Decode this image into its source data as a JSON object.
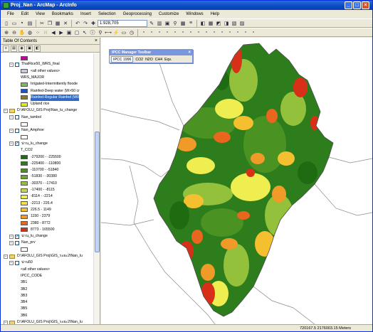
{
  "window": {
    "title": "Proj_Nan - ArcMap - ArcInfo"
  },
  "menu": [
    "File",
    "Edit",
    "View",
    "Bookmarks",
    "Insert",
    "Selection",
    "Geoprocessing",
    "Customize",
    "Windows",
    "Help"
  ],
  "toolbar": {
    "scale": "1:928,705"
  },
  "toc": {
    "title": "Table Of Contents",
    "rows": [
      {
        "type": "swatch",
        "color": "#c8009c",
        "label": ""
      },
      {
        "type": "layer",
        "label": "ThaiRice50_WRS_final",
        "checked": false
      },
      {
        "type": "swatch",
        "color": "#c9c6e6",
        "label": "<all other values>"
      },
      {
        "type": "text",
        "label": "WRS_MAJOR"
      },
      {
        "type": "swatch",
        "color": "#82b46a",
        "label": "Irrigated-Intermittently floode"
      },
      {
        "type": "swatch",
        "color": "#1a4fd6",
        "label": "Rainfed-Deep water (W>50 cr"
      },
      {
        "type": "swatch",
        "color": "#8a7a2a",
        "label": "Rainfed-Regular Rainfed (W0",
        "highlight": true
      },
      {
        "type": "swatch",
        "color": "#e8e820",
        "label": "Upland rice"
      },
      {
        "type": "group",
        "label": "D:\\AFOLU_GIS Proj\\Nan_lu_change"
      },
      {
        "type": "layer",
        "label": "Nan_tambol",
        "checked": false
      },
      {
        "type": "outline",
        "label": ""
      },
      {
        "type": "layer",
        "label": "Nan_Amphoe",
        "checked": false
      },
      {
        "type": "outline",
        "label": ""
      },
      {
        "type": "layer",
        "label": "น่าน_lu_change",
        "checked": true
      },
      {
        "type": "text",
        "label": "T_CO2"
      },
      {
        "type": "swatch",
        "color": "#1f6b12",
        "label": "-279200 - -225500"
      },
      {
        "type": "swatch",
        "color": "#2e7d1c",
        "label": "-225400 - -110800"
      },
      {
        "type": "swatch",
        "color": "#4a9322",
        "label": "-110700 - -51840"
      },
      {
        "type": "swatch",
        "color": "#6aa82e",
        "label": "-51830 - -30380"
      },
      {
        "type": "swatch",
        "color": "#93c13c",
        "label": "-30370 - -17410"
      },
      {
        "type": "swatch",
        "color": "#c3d84c",
        "label": "-17400 - -8115"
      },
      {
        "type": "swatch",
        "color": "#eeee50",
        "label": "-8114 - -2214"
      },
      {
        "type": "swatch",
        "color": "#f6e040",
        "label": "-2213 - 226.4"
      },
      {
        "type": "swatch",
        "color": "#f4c030",
        "label": "226.5 - 1149"
      },
      {
        "type": "swatch",
        "color": "#f09a28",
        "label": "1150 - 2379"
      },
      {
        "type": "swatch",
        "color": "#e8661e",
        "label": "2380 - 8772"
      },
      {
        "type": "swatch",
        "color": "#d83018",
        "label": "8773 - 165500"
      },
      {
        "type": "layer",
        "label": "น่าน_lu_change",
        "checked": true
      },
      {
        "type": "layer",
        "label": "Nan_prv",
        "checked": false
      },
      {
        "type": "outline",
        "label": ""
      },
      {
        "type": "group",
        "label": "D:\\AFOLU_GIS Proj\\GIS_ระยะ2\\Nan_lu"
      },
      {
        "type": "layer",
        "label": "น่าน50",
        "checked": false
      },
      {
        "type": "text",
        "label": "<all other values>"
      },
      {
        "type": "text",
        "label": "IPCC_CODE"
      },
      {
        "type": "text",
        "label": "3B1"
      },
      {
        "type": "text",
        "label": "3B2"
      },
      {
        "type": "text",
        "label": "3B3"
      },
      {
        "type": "text",
        "label": "3B4"
      },
      {
        "type": "text",
        "label": "3B5"
      },
      {
        "type": "text",
        "label": "3B6"
      },
      {
        "type": "group",
        "label": "D:\\AFOLU_GIS Proj\\GIS_ระยะ2\\Nan_lu"
      },
      {
        "type": "layer",
        "label": "น่าน45",
        "checked": false
      }
    ]
  },
  "ipcc_toolbar": {
    "title": "IPCC Manager Toolbar",
    "selected": "IPCC 1996",
    "items": [
      "CO2",
      "N2O",
      "CH4",
      "Eqv."
    ]
  },
  "status": {
    "coords": "720167.5  2176003.15 Meters"
  }
}
